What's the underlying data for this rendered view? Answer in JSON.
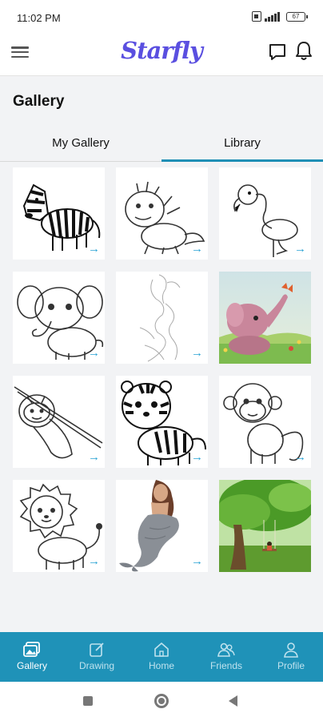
{
  "status_bar": {
    "time": "11:02 PM",
    "battery": "67"
  },
  "header": {
    "logo_text": "Starfly",
    "menu_icon": "hamburger-menu-icon",
    "chat_icon": "chat-bubble-icon",
    "bell_icon": "bell-icon"
  },
  "page": {
    "title": "Gallery"
  },
  "tabs": [
    {
      "label": "My Gallery",
      "active": false
    },
    {
      "label": "Library",
      "active": true
    }
  ],
  "gallery_items": [
    {
      "subject": "zebra",
      "style": "line-art",
      "arrow": "→"
    },
    {
      "subject": "baby dinosaur",
      "style": "line-art",
      "arrow": "→"
    },
    {
      "subject": "flamingo",
      "style": "line-art",
      "arrow": "→"
    },
    {
      "subject": "elephant",
      "style": "line-art",
      "arrow": "→"
    },
    {
      "subject": "woman sketch",
      "style": "sketch",
      "arrow": "→"
    },
    {
      "subject": "elephant with butterfly",
      "style": "color",
      "arrow": ""
    },
    {
      "subject": "sloth",
      "style": "line-art",
      "arrow": "→"
    },
    {
      "subject": "tiger",
      "style": "line-art",
      "arrow": "→"
    },
    {
      "subject": "monkey",
      "style": "line-art",
      "arrow": "→"
    },
    {
      "subject": "lion",
      "style": "line-art",
      "arrow": "→"
    },
    {
      "subject": "mermaid",
      "style": "color",
      "arrow": "→"
    },
    {
      "subject": "tree with swing",
      "style": "color",
      "arrow": ""
    }
  ],
  "bottom_nav": [
    {
      "label": "Gallery",
      "icon": "gallery-icon",
      "active": true
    },
    {
      "label": "Drawing",
      "icon": "drawing-icon",
      "active": false
    },
    {
      "label": "Home",
      "icon": "home-icon",
      "active": false
    },
    {
      "label": "Friends",
      "icon": "friends-icon",
      "active": false
    },
    {
      "label": "Profile",
      "icon": "profile-icon",
      "active": false
    }
  ],
  "colors": {
    "accent": "#1f92b8",
    "logo": "#5a4fe0",
    "arrow": "#28a3d3",
    "background": "#f2f3f5"
  }
}
